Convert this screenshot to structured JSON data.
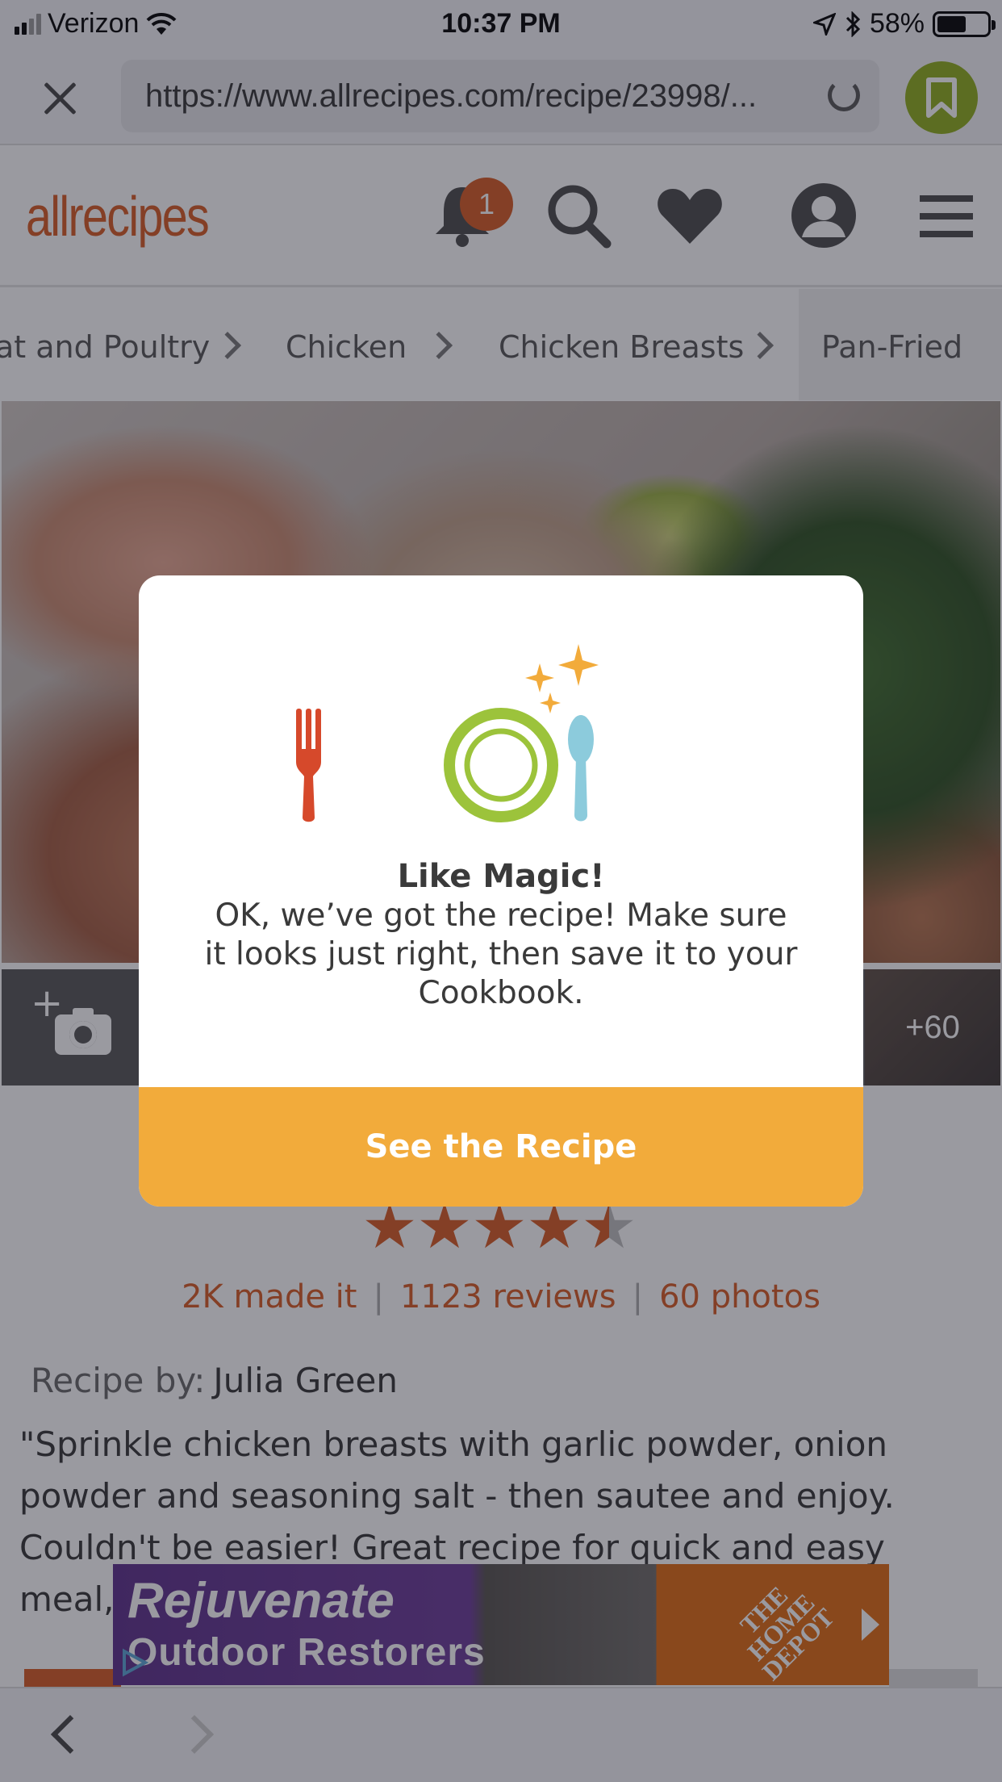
{
  "status_bar": {
    "carrier": "Verizon",
    "time": "10:37 PM",
    "battery": "58%",
    "battery_level": 0.58
  },
  "browser": {
    "url": "https://www.allrecipes.com/recipe/23998/...",
    "icons": [
      "close-icon",
      "reload-icon",
      "bookmark-icon"
    ],
    "bookmark_color": "#8fae1b"
  },
  "site_header": {
    "logo": "allrecipes",
    "notification_count": "1",
    "icons": [
      "bell-icon",
      "search-icon",
      "heart-icon",
      "profile-icon",
      "menu-icon"
    ],
    "brand_color": "#d75a21"
  },
  "breadcrumb": {
    "items": [
      "at and Poultry",
      "Chicken",
      "Chicken Breasts",
      "Pan-Fried"
    ]
  },
  "photos": {
    "more_count": "+60"
  },
  "rating": {
    "stars": 4.5,
    "max": 5
  },
  "stats": {
    "made_it": "2K made it",
    "reviews": "1123 reviews",
    "photos": "60 photos"
  },
  "recipe_by": {
    "label": "Recipe by:",
    "author": "Julia Green"
  },
  "description": "\"Sprinkle chicken breasts with garlic powder, onion powder and seasoning salt - then sautee and enjoy. Couldn't be easier! Great recipe for quick and easy meal, even f",
  "ad": {
    "title": "Rejuvenate",
    "subtitle": "Outdoor Restorers",
    "brand": "THE HOME DEPOT"
  },
  "modal": {
    "title": "Like Magic!",
    "body": "OK, we’ve got the recipe! Make sure it looks just right, then save it to your Cookbook.",
    "button_label": "See the Recipe",
    "button_color": "#f2ab3b"
  }
}
